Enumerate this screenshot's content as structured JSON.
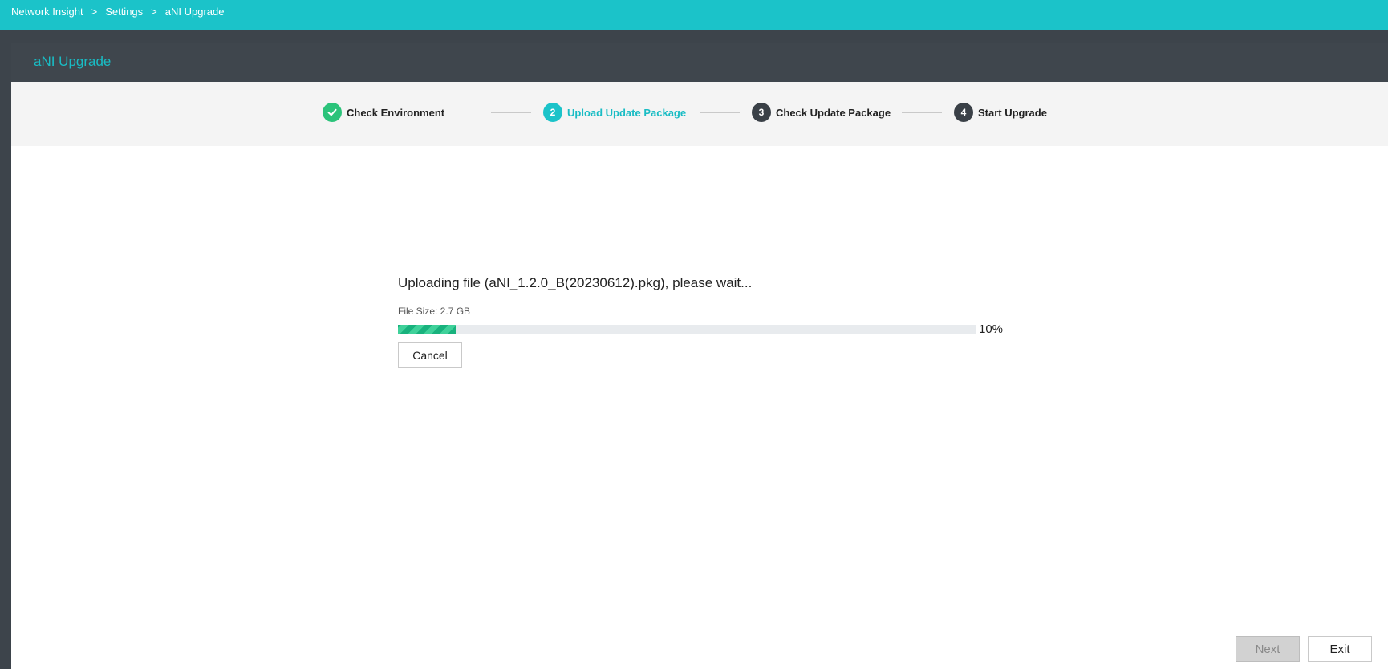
{
  "breadcrumb": {
    "items": [
      "Network Insight",
      "Settings",
      "aNI Upgrade"
    ],
    "separator": ">"
  },
  "panel": {
    "title": "aNI Upgrade"
  },
  "steps": [
    {
      "number": "",
      "label": "Check Environment",
      "state": "done"
    },
    {
      "number": "2",
      "label": "Upload Update Package",
      "state": "active"
    },
    {
      "number": "3",
      "label": "Check Update Package",
      "state": "pending"
    },
    {
      "number": "4",
      "label": "Start Upgrade",
      "state": "pending"
    }
  ],
  "upload": {
    "message": "Uploading file (aNI_1.2.0_B(20230612).pkg), please wait...",
    "file_size": "File Size: 2.7 GB",
    "progress_percent": 10,
    "progress_label": "10%",
    "cancel_label": "Cancel"
  },
  "footer": {
    "next_label": "Next",
    "exit_label": "Exit"
  },
  "colors": {
    "accent": "#1bc3c9",
    "done": "#2bc37a",
    "header_bg": "#3f464d"
  },
  "icons": {
    "done_step": "check-icon"
  }
}
